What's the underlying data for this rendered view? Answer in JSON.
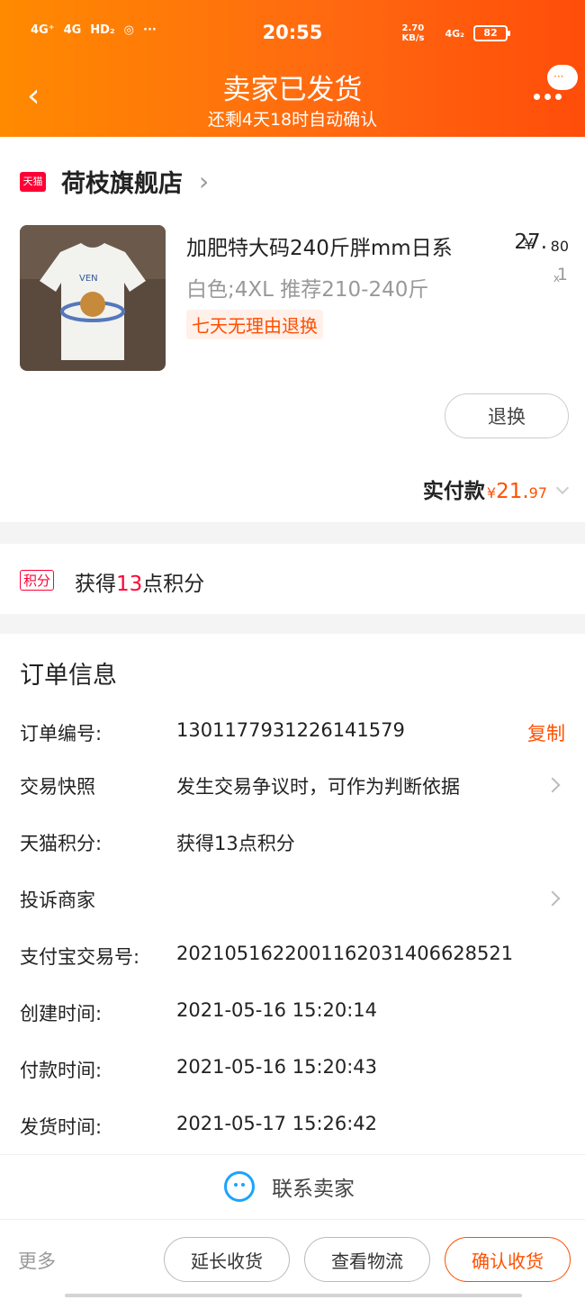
{
  "status_bar": {
    "signal_1": "4G⁺",
    "signal_2": "4G",
    "hd": "HD₂",
    "more": "···",
    "time": "20:55",
    "net_speed": "2.70 KB/s",
    "signal_3": "4G₂",
    "battery": "82"
  },
  "header": {
    "back": "‹",
    "title": "卖家已发货",
    "subtitle": "还剩4天18时自动确认",
    "bubble": "···"
  },
  "shop": {
    "badge": "天猫",
    "name": "荷枝旗舰店",
    "chevron": "›"
  },
  "product": {
    "title": "加肥特大码240斤胖mm日系",
    "sku": "白色;4XL 推荐210-240斤",
    "tag": "七天无理由退换",
    "price_currency": "¥",
    "price_int": "27.",
    "price_dec": "80",
    "qty_x": "x",
    "qty": "1",
    "refund_label": "退换"
  },
  "paid": {
    "label": "实付款",
    "currency": "¥",
    "int": "21.",
    "dec": "97"
  },
  "points": {
    "badge": "积分",
    "prefix": "获得",
    "value": "13",
    "suffix": "点积分"
  },
  "order_info": {
    "title": "订单信息",
    "rows": [
      {
        "label": "订单编号:",
        "value": "1301177931226141579",
        "action": "复制"
      },
      {
        "label": "交易快照",
        "value": "发生交易争议时，可作为判断依据"
      },
      {
        "label": "天猫积分:",
        "value": "获得13点积分"
      },
      {
        "label": "投诉商家",
        "value": ""
      },
      {
        "label": "支付宝交易号:",
        "value": "2021051622001162031406628521"
      },
      {
        "label": "创建时间:",
        "value": "2021-05-16 15:20:14"
      },
      {
        "label": "付款时间:",
        "value": "2021-05-16 15:20:43"
      },
      {
        "label": "发货时间:",
        "value": "2021-05-17 15:26:42"
      }
    ]
  },
  "contact": {
    "label": "联系卖家"
  },
  "bottom": {
    "more": "更多",
    "extend": "延长收货",
    "logistics": "查看物流",
    "confirm": "确认收货"
  },
  "colors": {
    "accent": "#ff5000",
    "header_start": "#ff8a00",
    "header_end": "#ff4d0a",
    "tmall_red": "#ff0036",
    "contact_blue": "#1aa3ff"
  },
  "icons": [
    "back-chevron-icon",
    "chat-bubble-icon",
    "tmall-icon",
    "chevron-right-icon",
    "chevron-down-icon",
    "smile-face-icon"
  ]
}
